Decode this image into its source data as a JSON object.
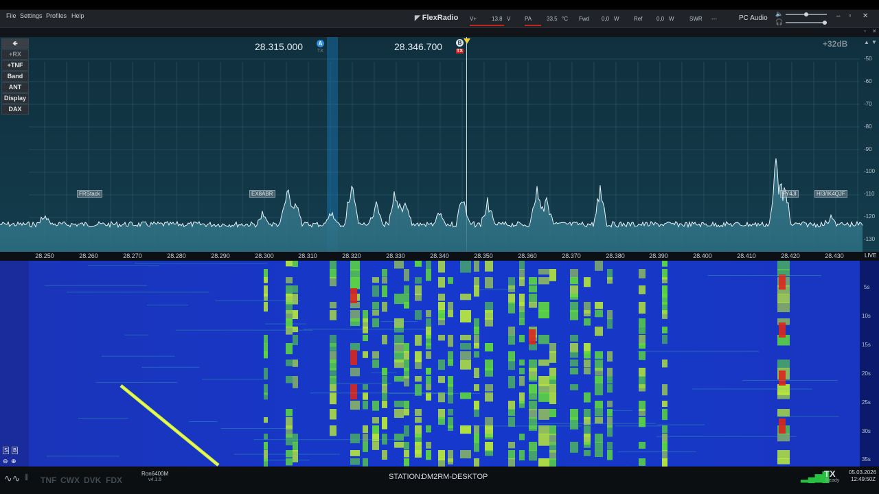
{
  "menu": {
    "file": "File",
    "settings": "Settings",
    "profiles": "Profiles",
    "help": "Help"
  },
  "brand": "FlexRadio",
  "telemetry": {
    "v_label": "V+",
    "v_value": "13,8",
    "v_unit": "V",
    "pa_label": "PA",
    "pa_value": "33,5",
    "pa_unit": "°C",
    "fwd_label": "Fwd",
    "fwd_value": "0,0",
    "fwd_unit": "W",
    "ref_label": "Ref",
    "ref_value": "0,0",
    "ref_unit": "W",
    "swr_label": "SWR",
    "swr_value": "---"
  },
  "audio": {
    "label": "PC Audio",
    "volume": 0.5,
    "balance": 1.0
  },
  "window": {
    "minimize": "–",
    "restore": "▫",
    "close": "✕"
  },
  "left_buttons": [
    "+RX",
    "+TNF",
    "Band",
    "ANT",
    "Display",
    "DAX"
  ],
  "vfo_a": {
    "freq": "28.315.000",
    "badge": "A",
    "sub": "TX"
  },
  "vfo_b": {
    "freq": "28.346.700",
    "badge": "B",
    "tx": "TX"
  },
  "gain": "+32dB",
  "db_scale": [
    "-50",
    "-60",
    "-70",
    "-80",
    "-90",
    "-100",
    "-110",
    "-120",
    "-130"
  ],
  "freq_ticks": [
    "28.250",
    "28.260",
    "28.270",
    "28.280",
    "28.290",
    "28.300",
    "28.310",
    "28.320",
    "28.330",
    "28.340",
    "28.350",
    "28.360",
    "28.370",
    "28.380",
    "28.390",
    "28.400",
    "28.410",
    "28.420",
    "28.430"
  ],
  "live": "LIVE",
  "time_scale": [
    "5s",
    "10s",
    "15s",
    "20s",
    "25s",
    "30s",
    "35s"
  ],
  "spots": [
    "FRStack",
    "EX8ABR",
    "FY4JI",
    "HI3/IK4QJF"
  ],
  "status": {
    "modes": [
      "TNF",
      "CWX",
      "DVK",
      "FDX"
    ],
    "radio_model": "Ron6400M",
    "radio_version": "v4.1.5",
    "station_label": "STATION:",
    "station_name": "DM2RM-DESKTOP",
    "tx": "TX",
    "tx_state": "Ready",
    "date": "05.03.2026",
    "time": "12:49:50Z"
  },
  "colors": {
    "accent": "#1e8ad6",
    "tx_red": "#d0241c",
    "wf_bg": "#1430c8",
    "signal": "#66e040"
  }
}
